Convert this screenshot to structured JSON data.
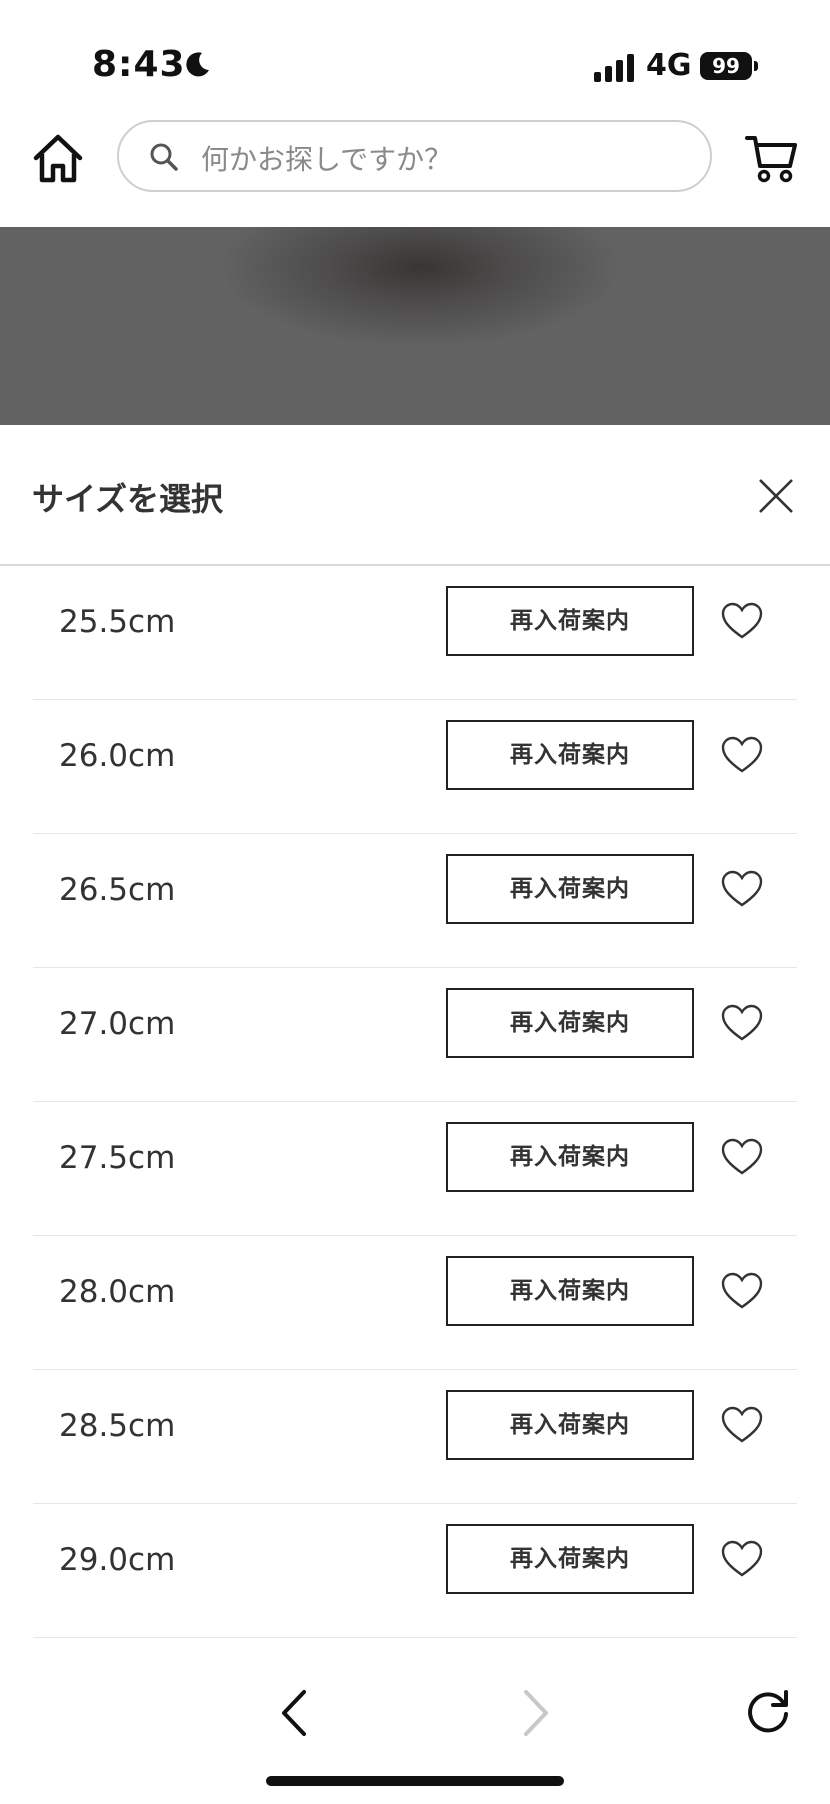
{
  "status_bar": {
    "time": "8:43",
    "network": "4G",
    "battery": "99"
  },
  "header": {
    "search_placeholder": "何かお探しですか？"
  },
  "sheet": {
    "title": "サイズを選択"
  },
  "sizes": [
    {
      "label": "25.5cm",
      "button": "再入荷案内"
    },
    {
      "label": "26.0cm",
      "button": "再入荷案内"
    },
    {
      "label": "26.5cm",
      "button": "再入荷案内"
    },
    {
      "label": "27.0cm",
      "button": "再入荷案内"
    },
    {
      "label": "27.5cm",
      "button": "再入荷案内"
    },
    {
      "label": "28.0cm",
      "button": "再入荷案内"
    },
    {
      "label": "28.5cm",
      "button": "再入荷案内"
    },
    {
      "label": "29.0cm",
      "button": "再入荷案内"
    }
  ],
  "icons": {
    "home": "home-icon",
    "search": "search-icon",
    "cart": "cart-icon",
    "close": "close-icon",
    "favorite": "heart-icon",
    "back": "chevron-left-icon",
    "forward": "chevron-right-icon",
    "reload": "reload-icon"
  },
  "colors": {
    "text": "#333333",
    "border": "#222222",
    "disabled": "#c8c8c8"
  }
}
